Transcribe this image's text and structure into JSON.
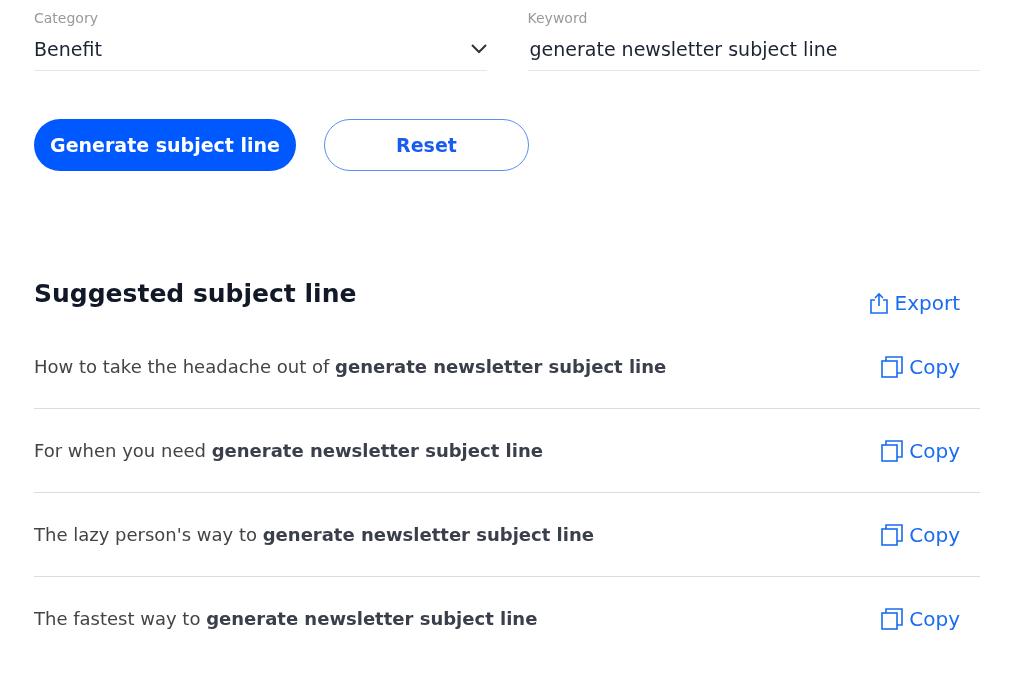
{
  "form": {
    "category": {
      "label": "Category",
      "value": "Benefit"
    },
    "keyword": {
      "label": "Keyword",
      "value": "generate newsletter subject line"
    }
  },
  "buttons": {
    "generate": "Generate subject line",
    "reset": "Reset"
  },
  "results": {
    "title": "Suggested subject line",
    "export": "Export",
    "items": [
      {
        "text": "How to take the headache out of **generate newsletter subject line**",
        "copy": "Copy"
      },
      {
        "text": "For when you need **generate newsletter subject line**",
        "copy": "Copy"
      },
      {
        "text": "The lazy person's way to **generate newsletter subject line**",
        "copy": "Copy"
      },
      {
        "text": "The fastest way to **generate newsletter subject line**",
        "copy": "Copy"
      }
    ]
  }
}
